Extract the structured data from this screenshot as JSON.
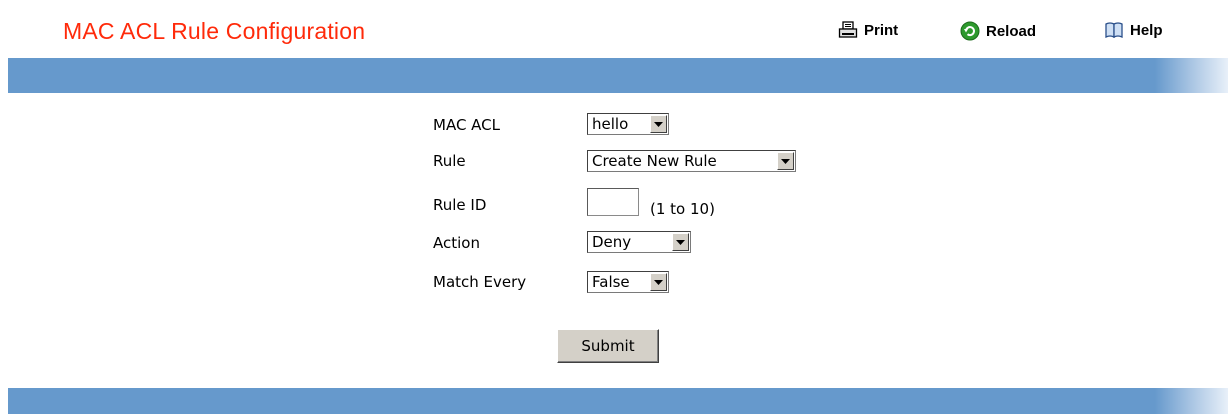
{
  "header": {
    "title": "MAC ACL Rule Configuration",
    "print_label": "Print",
    "reload_label": "Reload",
    "help_label": "Help"
  },
  "colors": {
    "title": "#ff2a0a",
    "band": "#6699cc",
    "button_face": "#d4d0c8"
  },
  "form": {
    "mac_acl": {
      "label": "MAC ACL",
      "value": "hello"
    },
    "rule": {
      "label": "Rule",
      "value": "Create New Rule"
    },
    "rule_id": {
      "label": "Rule ID",
      "value": "",
      "hint": "(1 to 10)"
    },
    "action": {
      "label": "Action",
      "value": "Deny"
    },
    "match_every": {
      "label": "Match Every",
      "value": "False"
    },
    "submit_label": "Submit"
  },
  "icons": {
    "print": "printer-icon",
    "reload": "reload-icon",
    "help": "help-book-icon",
    "dropdown": "dropdown-arrow-icon"
  }
}
